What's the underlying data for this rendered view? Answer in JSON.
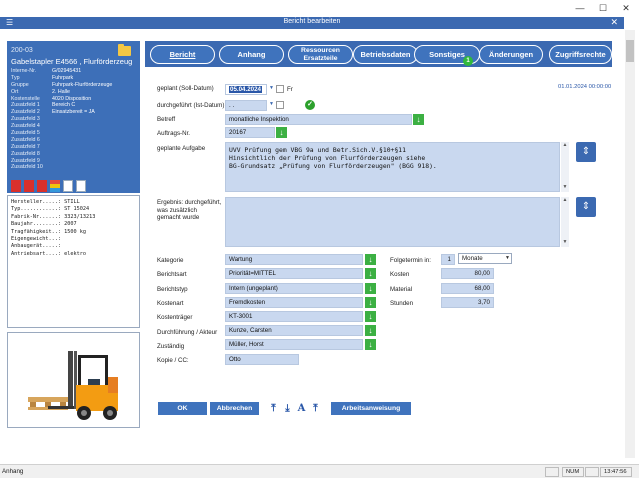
{
  "window": {
    "minimize_glyph": "—",
    "maximize_glyph": "☐",
    "close_glyph": "✕"
  },
  "dialog": {
    "title": "Bericht bearbeiten",
    "menu_glyph": "☰",
    "close_glyph": "✕"
  },
  "asset": {
    "id": "200-03",
    "name": "Gabelstapler E4566 , Flurförderzeug",
    "info": [
      {
        "k": "Interne-Nr.",
        "v": "G/02945431"
      },
      {
        "k": "Typ",
        "v": "Fuhrpark"
      },
      {
        "k": "Gruppe",
        "v": "Fuhrpark-Flurförderzeuge"
      },
      {
        "k": "Ort",
        "v": "2. Halle"
      },
      {
        "k": "Kostenstelle",
        "v": "4020 Disposition"
      },
      {
        "k": "Zusatzfeld 1",
        "v": "Bereich C"
      },
      {
        "k": "Zusatzfeld 2",
        "v": "Einsatzbereit = JA"
      },
      {
        "k": "Zusatzfeld 3",
        "v": ""
      },
      {
        "k": "Zusatzfeld 4",
        "v": ""
      },
      {
        "k": "Zusatzfeld 5",
        "v": ""
      },
      {
        "k": "Zusatzfeld 6",
        "v": ""
      },
      {
        "k": "Zusatzfeld 7",
        "v": ""
      },
      {
        "k": "Zusatzfeld 8",
        "v": ""
      },
      {
        "k": "Zusatzfeld 9",
        "v": ""
      },
      {
        "k": "Zusatzfeld 10",
        "v": ""
      }
    ],
    "notes": [
      "Hersteller.....: STILL",
      "Typ............: ST 15024",
      "",
      "Fabrik-Nr......: 3323/13213",
      "Baujahr........: 2007",
      "Tragfähigkeit..: 1500 kg",
      "Eigengewicht...:",
      "Anbaugerät.....:",
      "Antriebsart....: elektro"
    ]
  },
  "tabs": [
    {
      "label": "Bericht"
    },
    {
      "label": "Anhang"
    },
    {
      "label": "Ressourcen\nErsatzteile"
    },
    {
      "label": "Betriebsdaten"
    },
    {
      "label": "Sonstiges"
    },
    {
      "label": "Änderungen"
    },
    {
      "label": "Zugriffsrechte"
    }
  ],
  "badge_count": "1",
  "form": {
    "geplant_label": "geplant (Soll-Datum)",
    "geplant_value": "05.04.2024",
    "geplant_day": "Fr",
    "durchgefuehrt_label": "durchgeführt (Ist-Datum)",
    "durchgefuehrt_value": ". .",
    "betreff_label": "Betreff",
    "betreff_value": "monatliche Inspektion",
    "auftrag_label": "Auftrags-Nr.",
    "auftrag_value": "20167",
    "aufgabe_label": "geplante Aufgabe",
    "aufgabe_text": "UVV Prüfung gem VBG 9a und Betr.Sich.V.§10+§11\nHinsichtlich der Prüfung von Flurförderzeugen siehe\nBG-Grundsatz „Prüfung von Flurförderzeugen\" (BGG 918).",
    "ergebnis_label": "Ergebnis: durchgeführt,\nwas zusätzlich\ngemacht wurde",
    "ergebnis_text": "",
    "timestamp": "01.01.2024 00:00:00",
    "kategorie_label": "Kategorie",
    "kategorie_value": "Wartung",
    "berichtsart_label": "Berichtsart",
    "berichtsart_value": "Priorität=MITTEL",
    "berichtstyp_label": "Berichtstyp",
    "berichtstyp_value": "Intern (ungeplant)",
    "kostenart_label": "Kostenart",
    "kostenart_value": "Fremdkosten",
    "kostentraeger_label": "Kostenträger",
    "kostentraeger_value": "KT-3001",
    "durchfuehrung_label": "Durchführung / Akteur",
    "durchfuehrung_value": "Kunze, Carsten",
    "zustaendig_label": "Zuständig",
    "zustaendig_value": "Müller, Horst",
    "kopie_label": "Kopie / CC:",
    "kopie_value": "Otto",
    "folgetermin_label": "Folgetermin in:",
    "folgetermin_value": "1",
    "folgetermin_unit": "Monate",
    "kosten_label": "Kosten",
    "kosten_value": "80,00",
    "material_label": "Material",
    "material_value": "68,00",
    "stunden_label": "Stunden",
    "stunden_value": "3,70"
  },
  "buttons": {
    "ok": "OK",
    "abbrechen": "Abbrechen",
    "arbeitsanweisung": "Arbeitsanweisung"
  },
  "statusbar": {
    "text": "Anhang",
    "num": "NUM",
    "time": "13:47:56"
  }
}
